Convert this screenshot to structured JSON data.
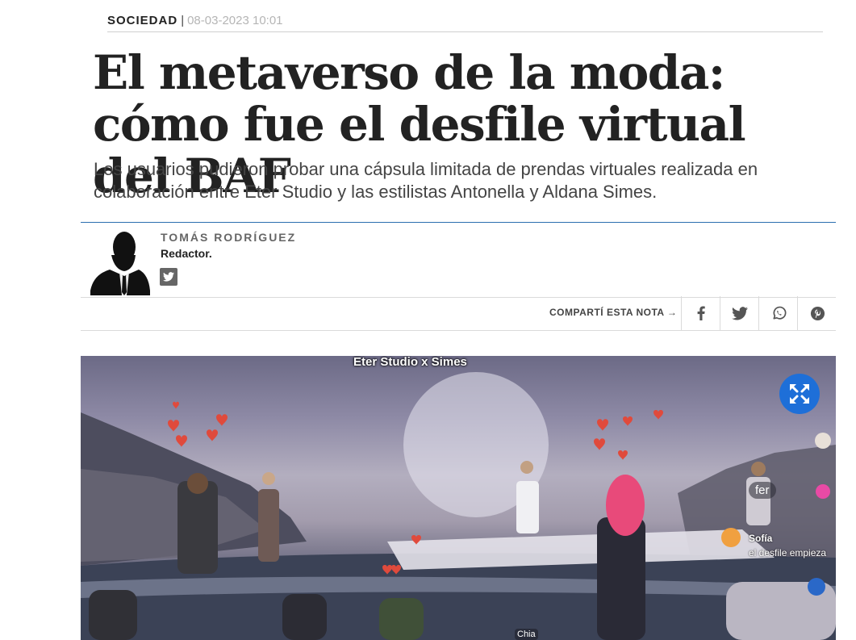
{
  "header": {
    "section": "SOCIEDAD",
    "separator": "|",
    "date": "08-03-2023 10:01"
  },
  "article": {
    "title": "El metaverso de la moda: cómo fue el desfile virtual del BAF",
    "subtitle": "Los usuarios pudieron probar una cápsula limitada de prendas virtuales realizada en colaboración entre Eter Studio y las estilistas Antonella y Aldana Simes."
  },
  "author": {
    "name": "TOMÁS RODRÍGUEZ",
    "role": "Redactor.",
    "social_icon": "twitter-icon"
  },
  "share": {
    "label": "COMPARTÍ ESTA NOTA →",
    "buttons": [
      "facebook-icon",
      "twitter-icon",
      "whatsapp-icon",
      "pinterest-icon"
    ]
  },
  "hero": {
    "caption": "Eter Studio x Simes",
    "expand_icon": "expand-arrows-icon",
    "bubble_text": "fer",
    "chat_name": "Sofía",
    "chat_message": "el desfile empieza",
    "bottom_tag": "Chia",
    "accent_color": "#1e6fd8"
  },
  "colors": {
    "divider_accent": "#2a6eb0",
    "text_primary": "#222222",
    "date_gray": "#b5b5b5",
    "icon_gray": "#666666"
  }
}
